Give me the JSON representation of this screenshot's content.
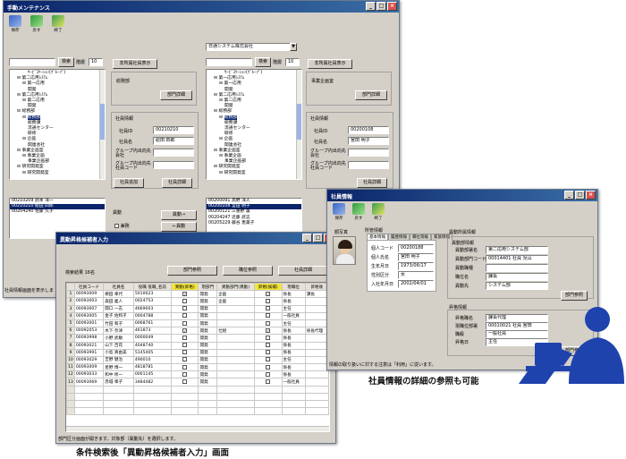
{
  "win1": {
    "title": "手動メンテナンス",
    "tools": [
      "保存",
      "戻す",
      "終了"
    ],
    "search_btn": "検索",
    "level_label": "階層",
    "level_value": "10",
    "retire_btn": "非所属社員表示",
    "tree": [
      "ｻｰﾋﾞｽｹｰｼｮﾝ(ｸﾞﾙｰﾌﾟ)",
      "第二応用ｼｽﾃﾑ",
      "第一応用",
      "開発",
      "第二応用ｼｽﾃﾑ",
      "第二応用",
      "開発",
      "総務部",
      "総務部",
      "総務課",
      "流通センター",
      "研修",
      "企画",
      "関連会社",
      "事業企画室",
      "事業企画",
      "事業企画部",
      "研究開発室",
      "研究開発室"
    ],
    "dept_name": "総務部",
    "dept_btn": "部門詳細",
    "emp_group": "社員情報",
    "emp_labels": [
      "社員ID",
      "社員名",
      "グループ内出向先会社",
      "グループ内出向先社員コード"
    ],
    "emp_id": "00210210",
    "emp_name": "総田 四郎",
    "add_btn": "社員追加",
    "detail_btn": "社員詳細",
    "list": [
      [
        "00210209",
        "武本 洋一"
      ],
      [
        "00210210",
        "総田 四郎"
      ],
      [
        "00204240",
        "佐藤 久子"
      ]
    ],
    "move_label": "異動",
    "move_check": "兼務",
    "move_right": "異動→",
    "move_left": "←異動",
    "status": "社員情報画面を表示しま"
  },
  "win1_right": {
    "company": "日通システム株式会社",
    "search_btn": "検索",
    "level_label": "階層",
    "level_value": "10",
    "retire_btn": "非所属社員表示",
    "tree": [
      "ｻｰﾋﾞｽｹｰｼｮﾝ(ｸﾞﾙｰﾌﾟ)",
      "第一応用ｼｽﾃﾑ",
      "第一応用",
      "開発",
      "第二応用ｼｽﾃﾑ",
      "第二応用",
      "開発",
      "総務部",
      "総務部",
      "総務課",
      "流通センター",
      "研修",
      "企画",
      "関連会社",
      "事業企画室",
      "事業企画",
      "事業企画部",
      "研究開発室",
      "研究開発室"
    ],
    "dept_name": "事業企画室",
    "dept_btn": "部門詳細",
    "emp_id": "00200108",
    "emp_name": "宮田 明子",
    "detail_btn": "社員詳細",
    "list": [
      [
        "00200091",
        "高野 洋人"
      ],
      [
        "00200108",
        "宮田 明子"
      ],
      [
        "00200121",
        "三重野 薫"
      ],
      [
        "00204247",
        "近藤 武志"
      ],
      [
        "00205229",
        "藤谷 恵美子"
      ]
    ]
  },
  "win2": {
    "title": "異動昇格候補者入力",
    "count_label": "検索結果",
    "count": "16名",
    "btns": [
      "部門参照",
      "職位参照",
      "社員詳細"
    ],
    "headers": [
      "社員コード",
      "社員名",
      "役職 役職_名前",
      "異動(昇格)",
      "現部門",
      "異動部門(異動)",
      "昇格(候補)",
      "現職位",
      "昇格後"
    ],
    "rows": [
      [
        "00093009",
        "柳田 幸代",
        "5010023",
        "✓",
        "開発",
        "企画",
        "✓",
        "係長",
        "課長"
      ],
      [
        "00093003",
        "森田 義人",
        "0024753",
        "",
        "開発",
        "企画",
        "",
        "係長",
        ""
      ],
      [
        "00093007",
        "関口 一志",
        "4669003",
        "",
        "開発",
        "",
        "",
        "主任",
        ""
      ],
      [
        "00093005",
        "金子 佐和子",
        "0004788",
        "",
        "開発",
        "",
        "",
        "一般社員",
        ""
      ],
      [
        "00093001",
        "竹田 和子",
        "0068761",
        "",
        "開発",
        "",
        "",
        "主任",
        ""
      ],
      [
        "00092053",
        "木下 奈津",
        "461873",
        "✓",
        "開発",
        "仕組",
        "✓",
        "係長",
        "係長代理"
      ],
      [
        "00093998",
        "小野 武敏",
        "0000049",
        "",
        "開発",
        "",
        "",
        "係長",
        ""
      ],
      [
        "00093021",
        "山下 百花",
        "4048740",
        "",
        "開発",
        "",
        "",
        "係長",
        ""
      ],
      [
        "00093991",
        "小島 真由美",
        "5145405",
        "",
        "開発",
        "",
        "",
        "係長",
        ""
      ],
      [
        "00093029",
        "吉野 健治",
        "490010",
        "",
        "開発",
        "",
        "",
        "主任",
        ""
      ],
      [
        "00093009",
        "星野 博一",
        "4818781",
        "",
        "開発",
        "",
        "",
        "係長",
        ""
      ],
      [
        "00093033",
        "和中 修一",
        "0001145",
        "",
        "開発",
        "",
        "",
        "係長",
        ""
      ],
      [
        "00093069",
        "赤城 幸子",
        "3484482",
        "",
        "開発",
        "",
        "",
        "一般社員",
        ""
      ]
    ],
    "status": "部門区分画面が開きます。対象部（異動先）を選択します。"
  },
  "win3": {
    "title": "社員情報",
    "tools": [
      "保存",
      "戻す",
      "終了"
    ],
    "photo_label": "顔写真",
    "section": "所管情報",
    "tabs": [
      "基本情報",
      "履歴情報",
      "職位等級",
      "家族情報"
    ],
    "basic": [
      [
        "個人コード",
        "00200188"
      ],
      [
        "個人氏名",
        "宮田 明子"
      ],
      [
        "生年月日",
        "1973/06/17"
      ],
      [
        "性別区分",
        "女"
      ],
      [
        "入社年月日",
        "2002/04/01"
      ]
    ],
    "affil_title": "異動所属情報",
    "affil_sub": "異動部情報",
    "affil": [
      [
        "異動部署名",
        "第二応用システム部"
      ],
      [
        "異動部門コード",
        "00014401 社員 児山"
      ],
      [
        "異動職種",
        ""
      ],
      [
        "職位名",
        "課長"
      ],
      [
        "異動先",
        "システム部"
      ]
    ],
    "affil_btn": "部門参照",
    "other_title": "昇格情報",
    "other": [
      [
        "昇格職名",
        "課長代理"
      ],
      [
        "現職位部署",
        "00010021 社員 宮田"
      ],
      [
        "職級",
        "一般社員"
      ],
      [
        "昇格日",
        "主任"
      ]
    ],
    "other_btn": "部門参照",
    "status": "情報の取り扱いに対する注意は「利用」に従います。"
  },
  "captions": {
    "bottom": "条件検索後「異動昇格候補者入力」画面",
    "right": "社員情報の詳細の参照も可能"
  },
  "colors": {
    "title_bar": "#0a246a",
    "window": "#d4d0c8",
    "highlight_col": "#f3e53a",
    "select": "#0a246a",
    "silhouette": "#1f43ad"
  },
  "icons": [
    "save-icon",
    "undo-icon",
    "exit-icon",
    "person-silhouette-icon",
    "monitor-icon"
  ]
}
